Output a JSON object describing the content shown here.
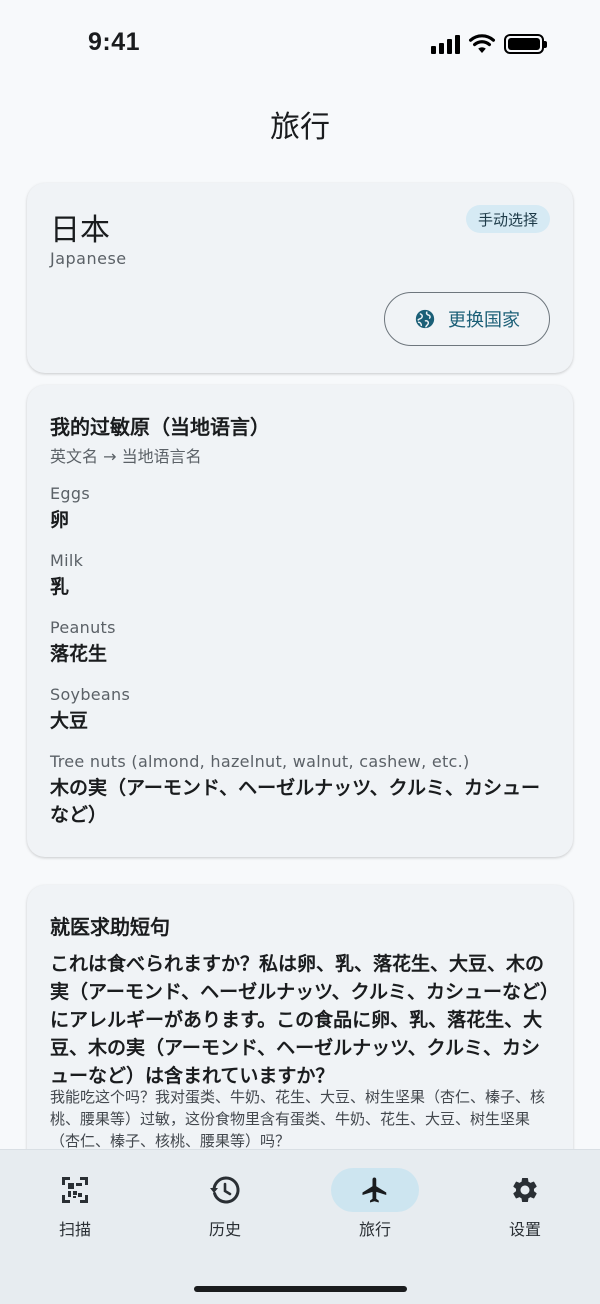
{
  "status_bar": {
    "time": "9:41"
  },
  "page": {
    "title": "旅行"
  },
  "country_card": {
    "country": "日本",
    "language": "Japanese",
    "badge": "手动选择",
    "change_button": "更换国家"
  },
  "allergens_card": {
    "title": "我的过敏原（当地语言）",
    "subtitle": "英文名 → 当地语言名",
    "items": [
      {
        "en": "Eggs",
        "local": "卵"
      },
      {
        "en": "Milk",
        "local": "乳"
      },
      {
        "en": "Peanuts",
        "local": "落花生"
      },
      {
        "en": "Soybeans",
        "local": "大豆"
      },
      {
        "en": "Tree nuts (almond, hazelnut, walnut, cashew, etc.)",
        "local": "木の実（アーモンド、ヘーゼルナッツ、クルミ、カシューなど）"
      }
    ]
  },
  "phrases_card": {
    "title": "就医求助短句",
    "local_phrase": "これは食べられますか？私は卵、乳、落花生、大豆、木の実（アーモンド、ヘーゼルナッツ、クルミ、カシューなど）にアレルギーがあります。この食品に卵、乳、落花生、大豆、木の実（アーモンド、ヘーゼルナッツ、クルミ、カシューなど）は含まれていますか？",
    "zh_phrase": "我能吃这个吗？我对蛋类、牛奶、花生、大豆、树生坚果（杏仁、榛子、核桃、腰果等）过敏，这份食物里含有蛋类、牛奶、花生、大豆、树生坚果（杏仁、榛子、核桃、腰果等）吗？"
  },
  "bottom_nav": {
    "items": [
      {
        "label": "扫描",
        "icon": "qr-scan-icon"
      },
      {
        "label": "历史",
        "icon": "history-icon"
      },
      {
        "label": "旅行",
        "icon": "airplane-icon",
        "active": true
      },
      {
        "label": "设置",
        "icon": "gear-icon"
      }
    ]
  },
  "colors": {
    "accent": "#1b5f77",
    "active_pill": "#cde5f0",
    "card_bg": "#f0f3f6",
    "page_bg": "#f7f9fb"
  }
}
